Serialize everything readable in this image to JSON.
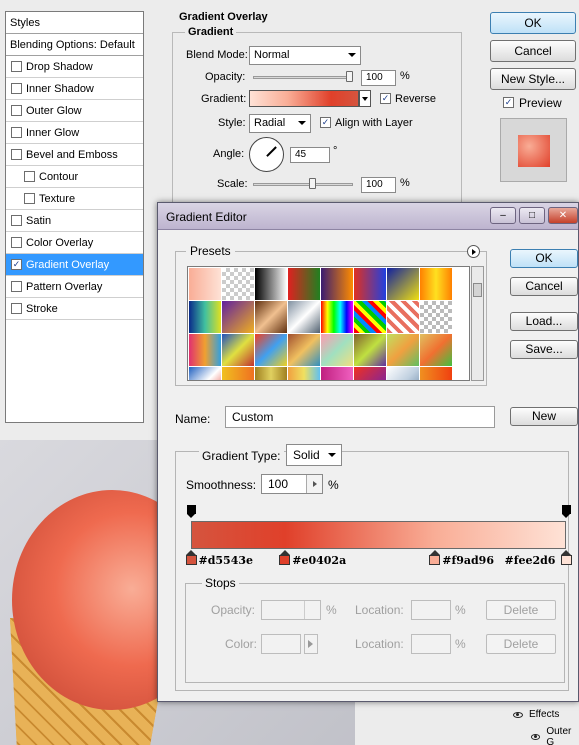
{
  "layer_style": {
    "styles_header": "Styles",
    "blending_options": "Blending Options: Default",
    "items": [
      {
        "label": "Drop Shadow",
        "checked": false
      },
      {
        "label": "Inner Shadow",
        "checked": false
      },
      {
        "label": "Outer Glow",
        "checked": false
      },
      {
        "label": "Inner Glow",
        "checked": false
      },
      {
        "label": "Bevel and Emboss",
        "checked": false
      },
      {
        "label": "Contour",
        "checked": false
      },
      {
        "label": "Texture",
        "checked": false
      },
      {
        "label": "Satin",
        "checked": false
      },
      {
        "label": "Color Overlay",
        "checked": false
      },
      {
        "label": "Gradient Overlay",
        "checked": true
      },
      {
        "label": "Pattern Overlay",
        "checked": false
      },
      {
        "label": "Stroke",
        "checked": false
      }
    ],
    "section_title": "Gradient Overlay",
    "group_title": "Gradient",
    "blend_mode_label": "Blend Mode:",
    "blend_mode_value": "Normal",
    "opacity_label": "Opacity:",
    "opacity_value": "100",
    "opacity_unit": "%",
    "gradient_label": "Gradient:",
    "reverse_label": "Reverse",
    "reverse_checked": true,
    "style_label": "Style:",
    "style_value": "Radial",
    "align_label": "Align with Layer",
    "align_checked": true,
    "angle_label": "Angle:",
    "angle_value": "45",
    "angle_unit": "°",
    "scale_label": "Scale:",
    "scale_value": "100",
    "scale_unit": "%",
    "ok_label": "OK",
    "cancel_label": "Cancel",
    "new_style_label": "New Style...",
    "preview_label": "Preview",
    "preview_checked": true,
    "checkmark": "✓"
  },
  "gradient_editor": {
    "title": "Gradient Editor",
    "presets_label": "Presets",
    "ok_label": "OK",
    "cancel_label": "Cancel",
    "load_label": "Load...",
    "save_label": "Save...",
    "name_label": "Name:",
    "name_value": "Custom",
    "new_label": "New",
    "gradient_type_label": "Gradient Type:",
    "gradient_type_value": "Solid",
    "smoothness_label": "Smoothness:",
    "smoothness_value": "100",
    "smoothness_unit": "%",
    "color_stops": [
      {
        "label": "#d5543e",
        "color": "#d5543e",
        "location": 0
      },
      {
        "label": "#e0402a",
        "color": "#e0402a",
        "location": 25
      },
      {
        "label": "#f9ad96",
        "color": "#f9ad96",
        "location": 65
      },
      {
        "label": "#fee2d6",
        "color": "#fee2d6",
        "location": 100
      }
    ],
    "opacity_stops": [
      {
        "opacity": 100,
        "location": 0
      },
      {
        "opacity": 100,
        "location": 100
      }
    ],
    "stops_group_label": "Stops",
    "stops_opacity_label": "Opacity:",
    "stops_opacity_unit": "%",
    "stops_color_label": "Color:",
    "location_label": "Location:",
    "location_unit": "%",
    "delete_label": "Delete",
    "window_controls": [
      "minimize-icon",
      "maximize-icon",
      "close-icon"
    ]
  },
  "layers_panel": {
    "effects_label": "Effects",
    "outer_label": "Outer G"
  },
  "colors": {
    "selection_blue": "#3399ff",
    "accent_default_button": "#bfe1f7"
  }
}
